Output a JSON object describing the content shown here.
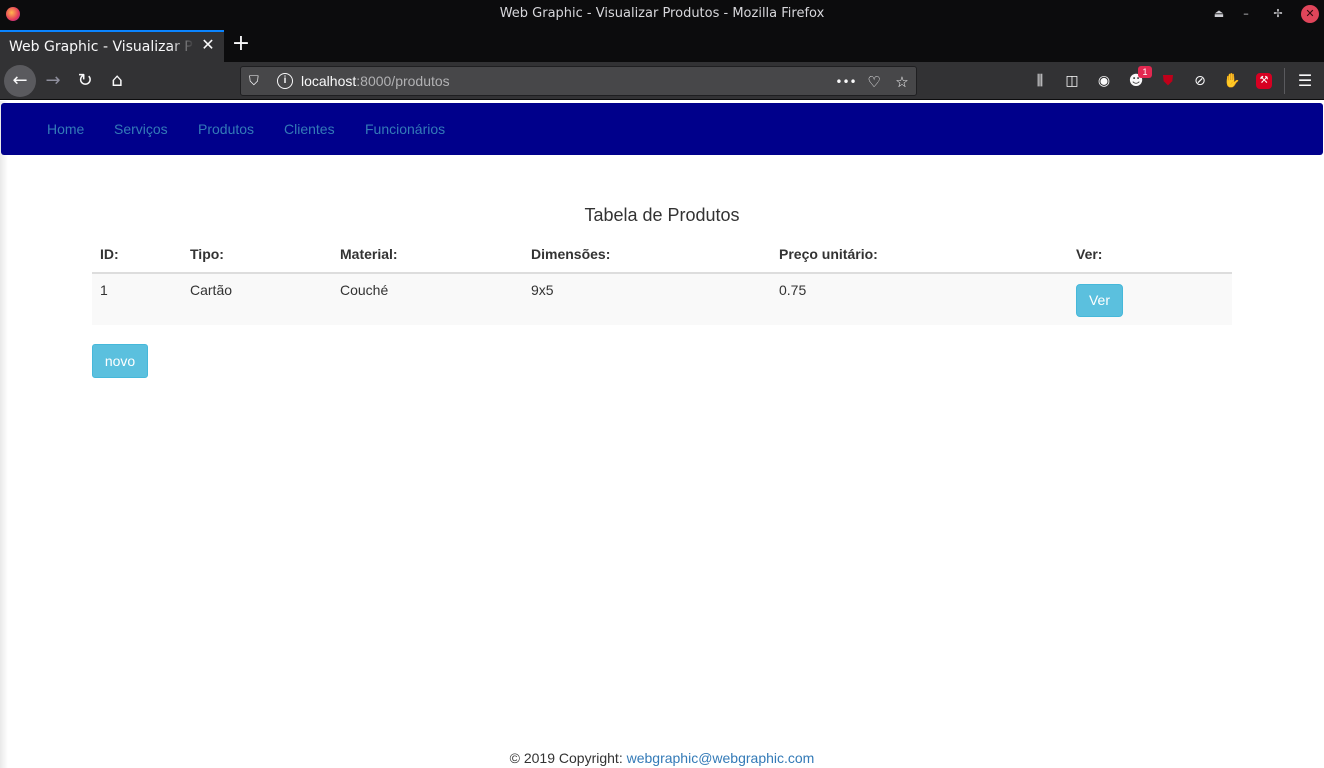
{
  "window": {
    "title": "Web Graphic - Visualizar Produtos - Mozilla Firefox"
  },
  "tab": {
    "title": "Web Graphic - Visualizar Produtos",
    "close_glyph": "✕",
    "new_tab_glyph": "+"
  },
  "toolbar": {
    "url_host": "localhost",
    "url_rest": ":8000/produtos",
    "notification_badge": "1",
    "page_actions_glyph": "•••"
  },
  "site_nav": {
    "items": [
      "Home",
      "Serviços",
      "Produtos",
      "Clientes",
      "Funcionários"
    ]
  },
  "table": {
    "caption": "Tabela de Produtos",
    "headers": [
      "ID:",
      "Tipo:",
      "Material:",
      "Dimensões:",
      "Preço unitário:",
      "Ver:"
    ],
    "rows": [
      {
        "id": "1",
        "tipo": "Cartão",
        "material": "Couché",
        "dimensoes": "9x5",
        "preco": "0.75",
        "action": "Ver"
      }
    ]
  },
  "buttons": {
    "new": "novo"
  },
  "footer": {
    "text": "© 2019 Copyright: ",
    "link": "webgraphic@webgraphic.com"
  },
  "colors": {
    "nav_bg": "#00008b",
    "link": "#337ab7",
    "info_button": "#5bc0de",
    "firefox_chrome": "#323234",
    "accent": "#0a84ff"
  },
  "icons": {
    "back": "arrow-left-icon",
    "forward": "arrow-right-icon",
    "reload": "reload-icon",
    "home": "home-icon",
    "tracking": "shield-icon",
    "info": "info-icon",
    "pocket": "pocket-icon",
    "bookmark": "star-icon",
    "library": "library-icon",
    "sidebar": "sidebar-icon",
    "account": "account-icon",
    "menu": "hamburger-menu-icon"
  }
}
